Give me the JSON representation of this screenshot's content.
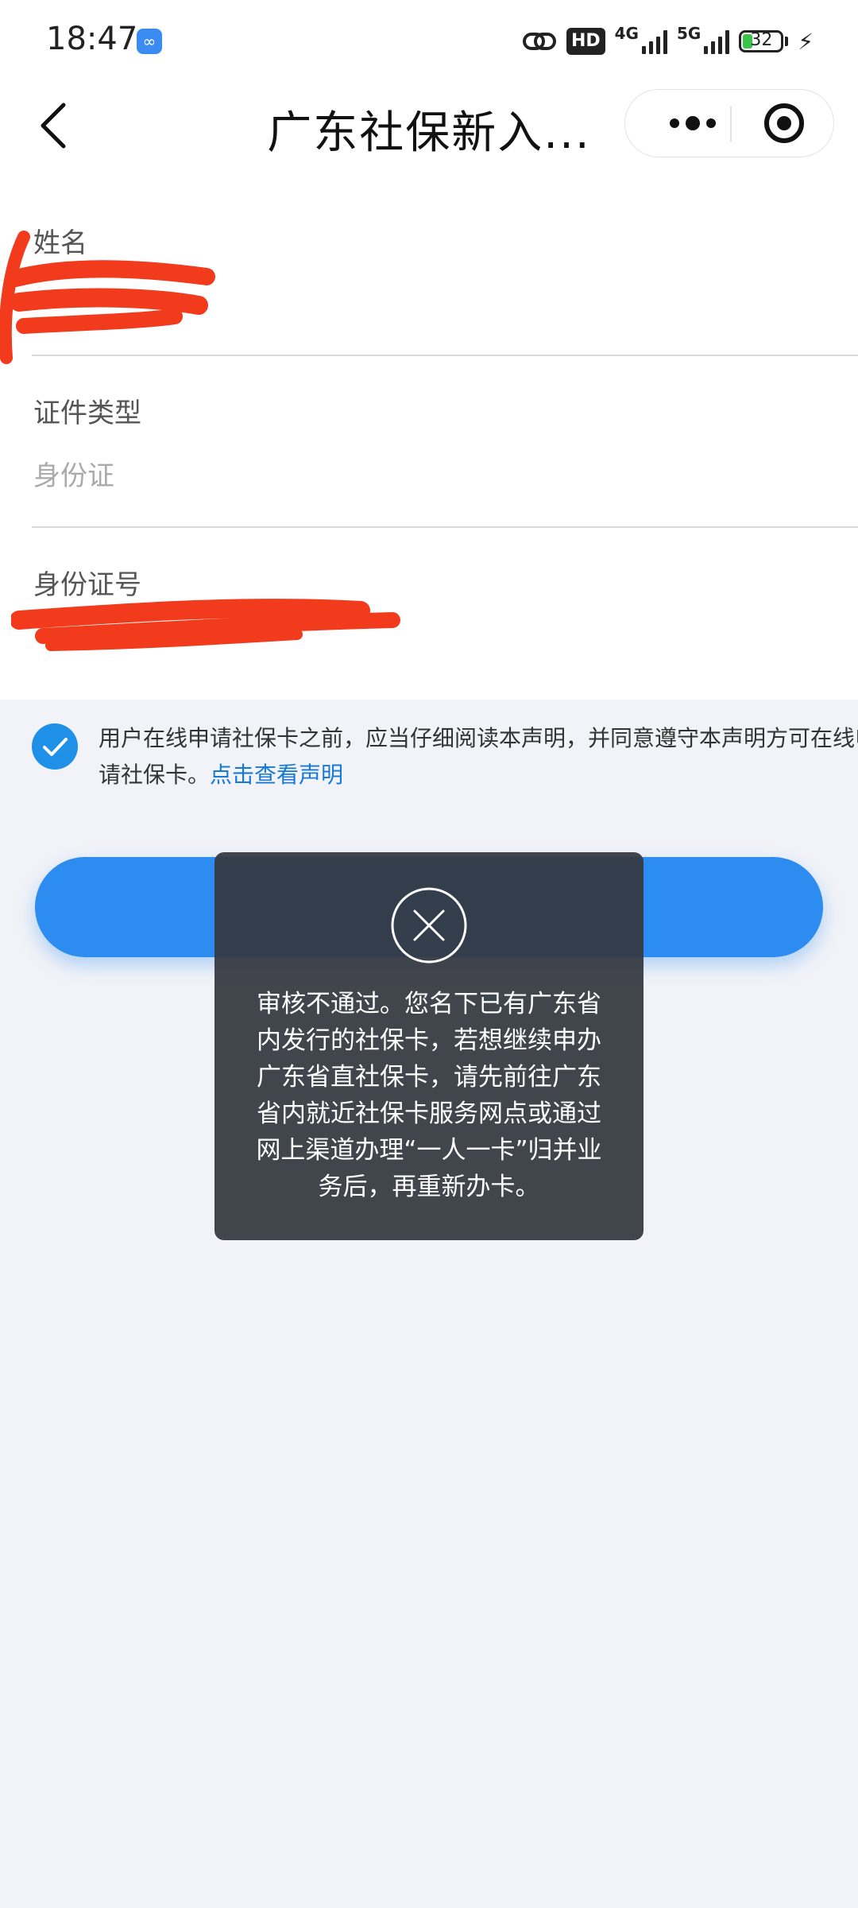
{
  "status_bar": {
    "time": "18:47",
    "hd_label": "HD",
    "net1": "4G",
    "net2": "5G",
    "battery": "32"
  },
  "nav": {
    "title": "广东社保新入..."
  },
  "form": {
    "name_label": "姓名",
    "id_type_label": "证件类型",
    "id_type_value": "身份证",
    "id_number_label": "身份证号"
  },
  "agreement": {
    "text": "用户在线申请社保卡之前，应当仔细阅读本声明，并同意遵守本声明方可在线申请社保卡。",
    "link": "点击查看声明",
    "checked": true
  },
  "primary_button": {
    "label": ""
  },
  "toast": {
    "message": "审核不通过。您名下已有广东省内发行的社保卡，若想继续申办广东省直社保卡，请先前往广东省内就近社保卡服务网点或通过网上渠道办理“一人一卡”归并业务后，再重新办卡。"
  },
  "colors": {
    "accent": "#2d8cf0",
    "link": "#1878d6",
    "redaction": "#f23a1c"
  }
}
